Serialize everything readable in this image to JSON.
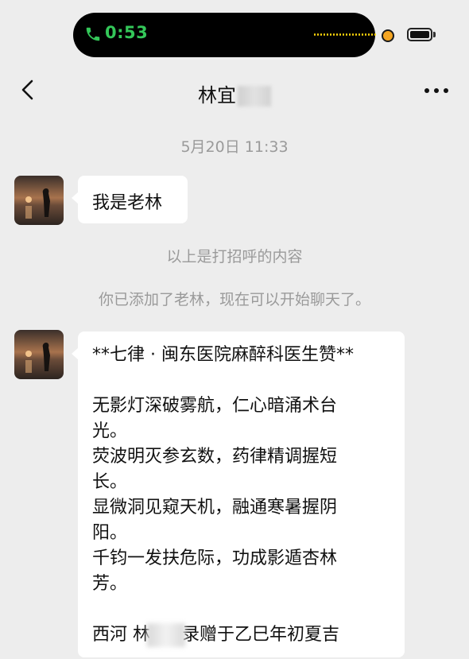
{
  "status": {
    "call_time": "0:53"
  },
  "header": {
    "title": "林宜"
  },
  "chat": {
    "timestamp": "5月20日 11:33",
    "greeting_message": "我是老林",
    "system_notes": [
      "以上是打招呼的内容",
      "你已添加了老林，现在可以开始聊天了。"
    ],
    "poem": {
      "title": "**七律 · 闽东医院麻醉科医生赞**",
      "lines": [
        "无影灯深破雾航，仁心暗涌术台",
        "光。",
        "荧波明灭参玄数，药律精调握短",
        "长。",
        "显微洞见窥天机，融通寒暑握阴",
        "阳。",
        "千钧一发扶危际，功成影遁杏林",
        "芳。"
      ],
      "signature_start": "西河 林",
      "signature_end": "录赠于乙巳年初夏吉"
    }
  },
  "colors": {
    "call_green": "#34c759",
    "background": "#ededed",
    "bubble": "#ffffff",
    "muted_text": "#9a9a9a"
  }
}
